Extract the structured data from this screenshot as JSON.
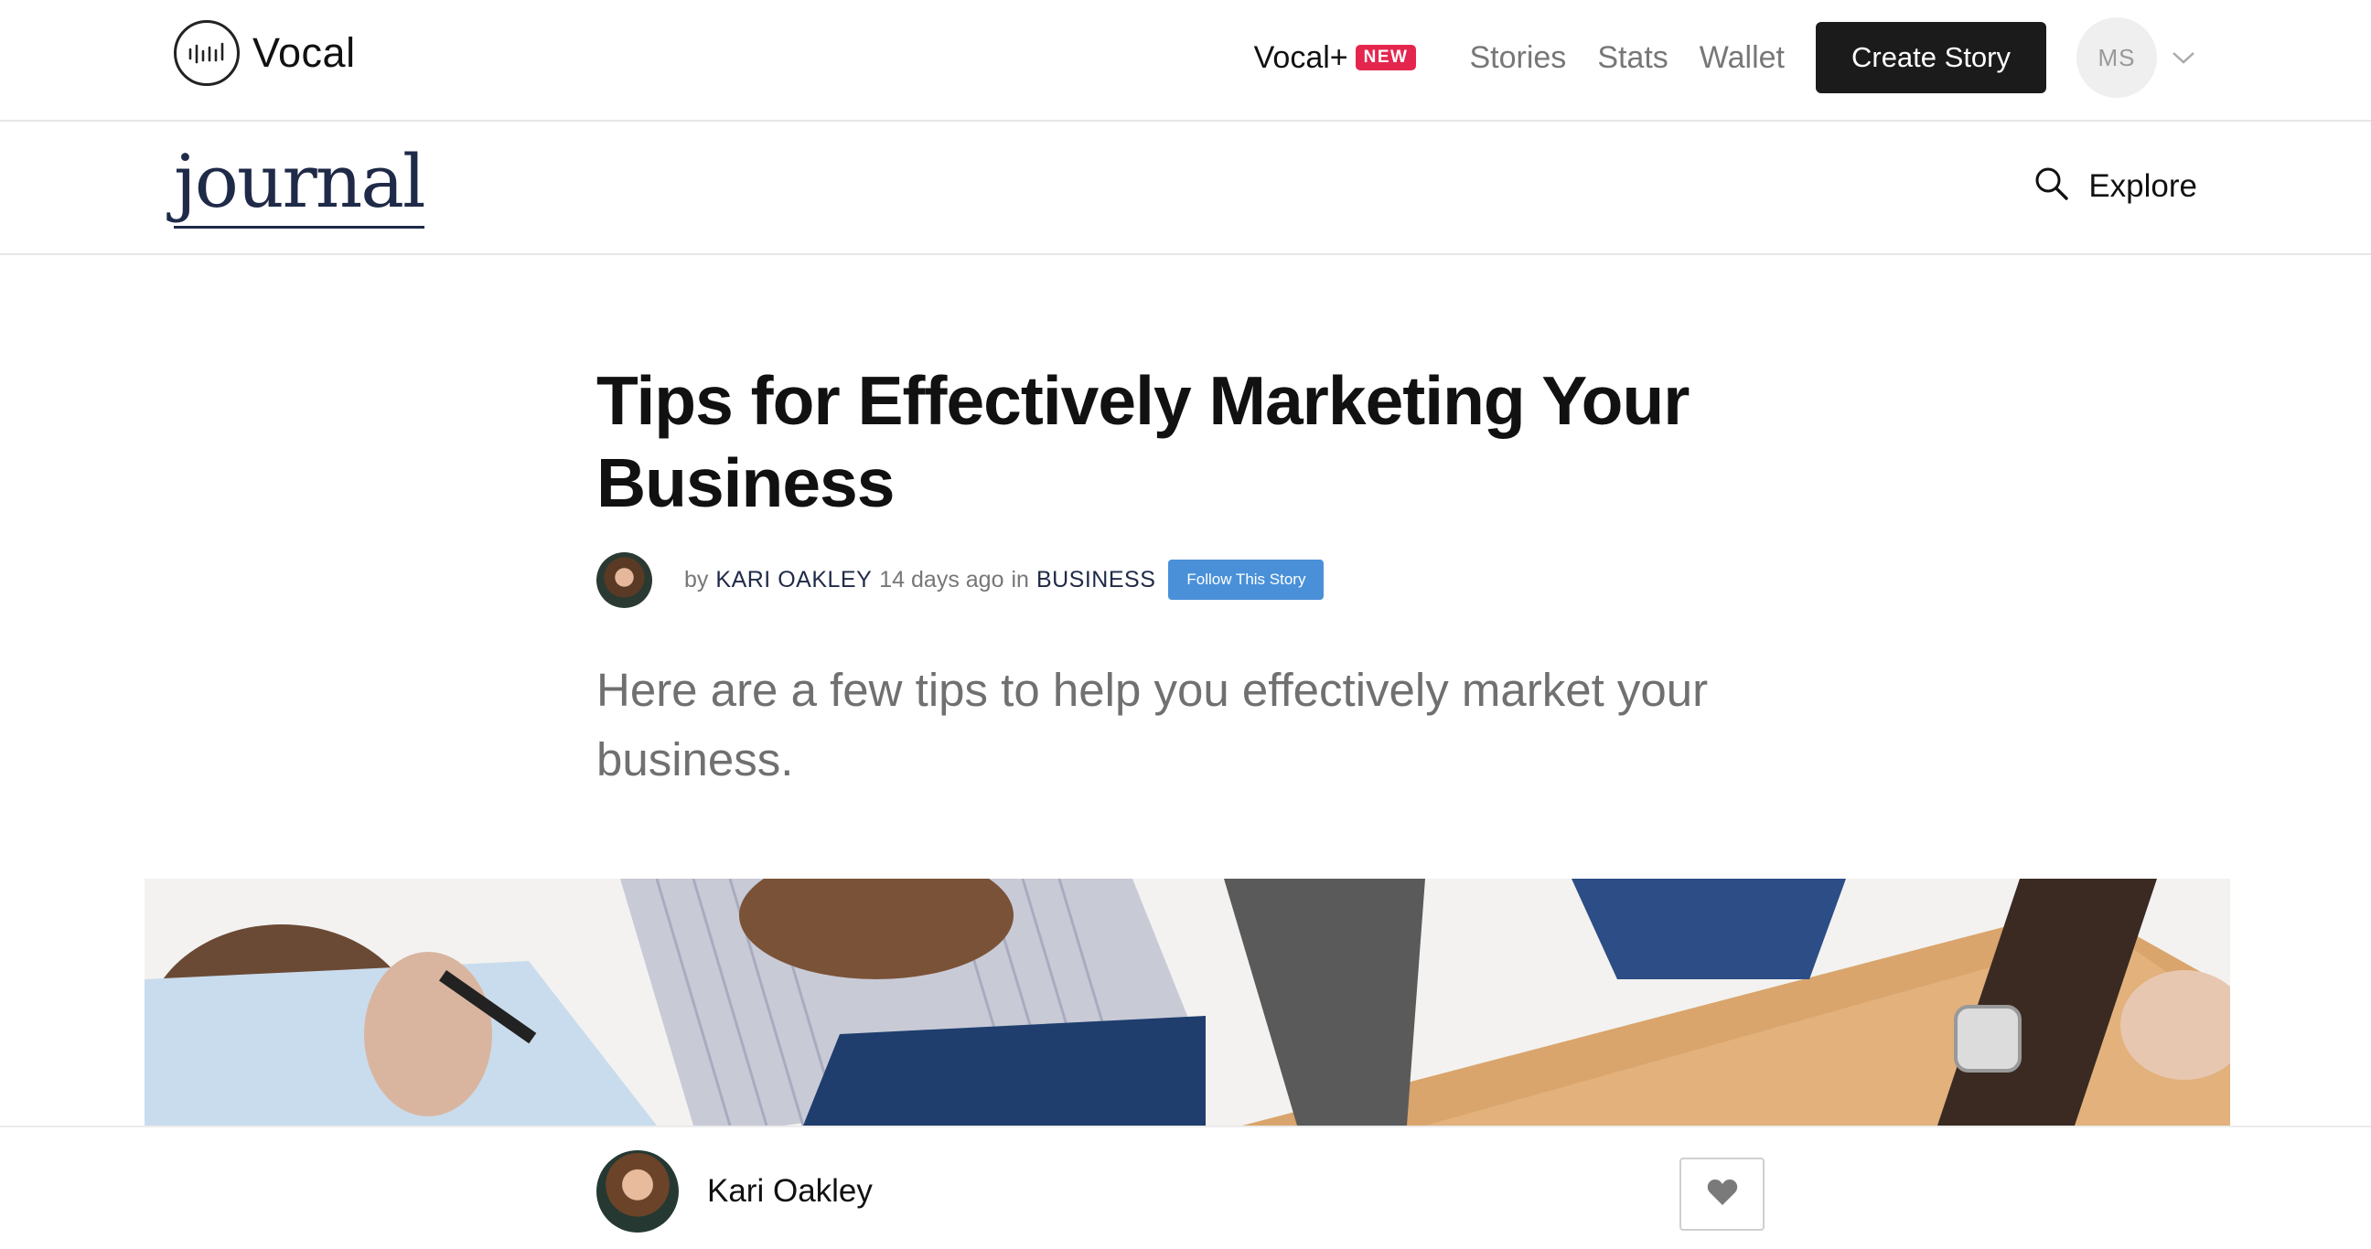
{
  "header": {
    "brand": "Vocal",
    "nav": {
      "vocal_plus": "Vocal+",
      "new_badge": "NEW",
      "stories": "Stories",
      "stats": "Stats",
      "wallet": "Wallet"
    },
    "create_button": "Create Story",
    "user_initials": "MS",
    "badge_color": "#e4264f"
  },
  "subheader": {
    "community": "journal",
    "explore": "Explore"
  },
  "article": {
    "title": "Tips for Effectively Marketing Your Business",
    "by": "by",
    "author": "KARI OAKLEY",
    "posted": "14 days ago",
    "in": "in",
    "category": "BUSINESS",
    "follow_button": "Follow This Story",
    "subtitle": "Here are a few tips to help you effectively market your business.",
    "follow_color": "#4a90d9"
  },
  "footer_bar": {
    "author_name": "Kari Oakley"
  },
  "icons": [
    "vocal-logo-icon",
    "chevron-down-icon",
    "search-icon",
    "heart-icon"
  ]
}
